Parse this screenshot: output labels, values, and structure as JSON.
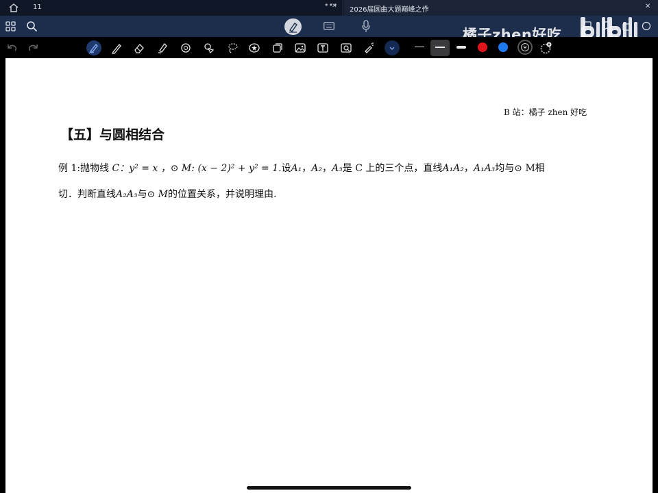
{
  "tabs": {
    "home_tab_label": "11",
    "active_tab_title": "2026届圆曲大题巅峰之作"
  },
  "watermark": {
    "channel_name": "橘子zhen好吃",
    "platform_logo": "bilibili"
  },
  "toolbar": {
    "tools": [
      "undo-icon",
      "redo-icon",
      "pen-icon",
      "pencil-icon",
      "eraser-icon",
      "highlighter-icon",
      "shapes-icon",
      "elements-icon",
      "lasso-icon",
      "star-sticker-icon",
      "shapes-copy-icon",
      "image-icon",
      "text-icon",
      "scan-image-icon",
      "laser-pointer-icon",
      "chevron-icon"
    ],
    "colors": {
      "red": "#e0141b",
      "blue": "#1e78f0",
      "black": "#111111"
    }
  },
  "document": {
    "credit": "B 站：橘子 zhen 好吃",
    "section_title": "【五】与圆相结合",
    "problem": {
      "prefix": "例 1:抛物线 ",
      "curve_name": "C",
      "curve_eq": "：y² = x ，",
      "circle_sym": "⊙",
      "circle_name": " M",
      "circle_eq": ": (x − 2)² + y² = 1",
      "text1": ".设",
      "a1": "A₁",
      "comma1": "，",
      "a2": "A₂",
      "comma2": "，",
      "a3": "A₃",
      "text2": "是 C 上的三个点，直线",
      "a1a2": "A₁A₂",
      "comma3": "，",
      "a1a3": "A₁A₃",
      "text3": "均与⊙ M相",
      "line2_text1": "切．判断直线",
      "a2a3": "A₂A₃",
      "line2_text2": "与⊙ ",
      "line2_m": "M",
      "line2_text3": "的位置关系，并说明理由."
    }
  }
}
